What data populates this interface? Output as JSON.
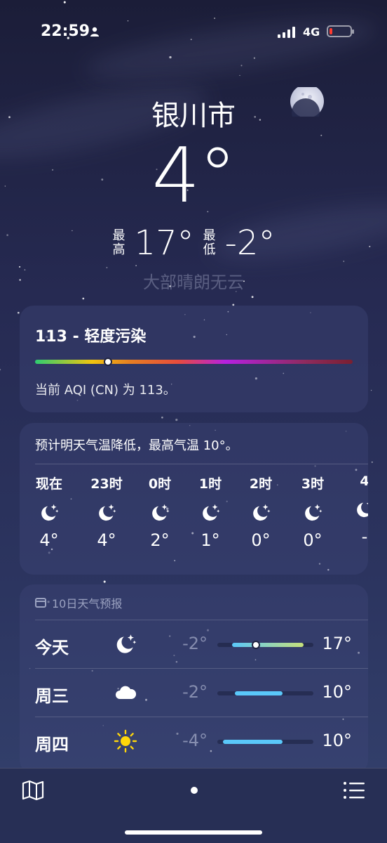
{
  "status_bar": {
    "time": "22:59",
    "network": "4G",
    "battery_level_pct": 8,
    "icons": [
      "person-icon",
      "signal-icon",
      "battery-icon"
    ]
  },
  "location": {
    "city": "银川市",
    "current_temp": "4°",
    "high_label": "最高",
    "high": "17°",
    "low_label": "最低",
    "low": "-2°",
    "condition": "大部晴朗无云"
  },
  "aqi": {
    "title": "113 - 轻度污染",
    "description": "当前 AQI (CN) 为 113。",
    "indicator_fraction": 0.23
  },
  "hourly": {
    "note": "预计明天气温降低，最高气温 10°。",
    "items": [
      {
        "label": "现在",
        "icon": "moon-stars-icon",
        "temp": "4°"
      },
      {
        "label": "23时",
        "icon": "moon-stars-icon",
        "temp": "4°"
      },
      {
        "label": "0时",
        "icon": "moon-stars-icon",
        "temp": "2°"
      },
      {
        "label": "1时",
        "icon": "moon-stars-icon",
        "temp": "1°"
      },
      {
        "label": "2时",
        "icon": "moon-stars-icon",
        "temp": "0°"
      },
      {
        "label": "3时",
        "icon": "moon-stars-icon",
        "temp": "0°"
      },
      {
        "label": "4",
        "icon": "moon-stars-icon",
        "temp": "-"
      }
    ]
  },
  "daily": {
    "header": "10日天气预报",
    "days": [
      {
        "day": "今天",
        "icon": "moon-stars-icon",
        "low": "-2°",
        "high": "17°",
        "range": [
          0.15,
          0.9
        ],
        "current": 0.4,
        "colors": [
          "#5ac8fa",
          "#c6e07a"
        ]
      },
      {
        "day": "周三",
        "icon": "cloud-icon",
        "low": "-2°",
        "high": "10°",
        "range": [
          0.18,
          0.68
        ],
        "colors": [
          "#5ac8fa",
          "#5ac8fa"
        ]
      },
      {
        "day": "周四",
        "icon": "sun-icon",
        "low": "-4°",
        "high": "10°",
        "range": [
          0.06,
          0.68
        ],
        "colors": [
          "#5ac8fa",
          "#5ac8fa"
        ]
      }
    ]
  },
  "bottom_bar": {
    "icons": [
      "map-icon",
      "page-indicator",
      "list-icon"
    ]
  }
}
